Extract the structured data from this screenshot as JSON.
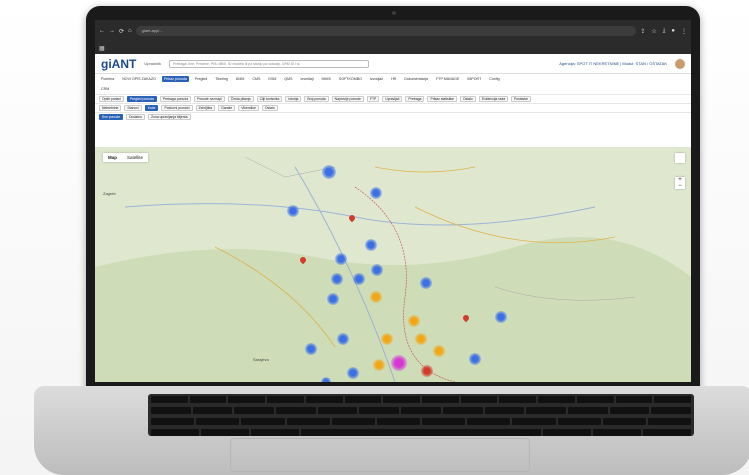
{
  "browser": {
    "url": "giant.app/..."
  },
  "app": {
    "logo": "giANT",
    "user": "Uprawnik",
    "search_placeholder": "Pretraga: Ime, Prezime, PIB, MBS, ID modela ili po stanju po sokaciji, CRM ID i sl.",
    "agency": "Agencija: SPOT IT NEKRETNINE | Modul: STAN / OSTATAK"
  },
  "menu": [
    {
      "label": "Početna",
      "active": false
    },
    {
      "label": "NOVI OPIS ZAKAZO",
      "active": false
    },
    {
      "label": "Prikaz ponuda",
      "active": true
    },
    {
      "label": "Pregled",
      "active": false
    },
    {
      "label": "Tiketing",
      "active": false
    },
    {
      "label": "DMM",
      "active": false
    },
    {
      "label": "CMS",
      "active": false
    },
    {
      "label": "DSM",
      "active": false
    },
    {
      "label": "QMS",
      "active": false
    },
    {
      "label": "Izveštaji",
      "active": false
    },
    {
      "label": "MMIS",
      "active": false
    },
    {
      "label": "SOFTKOMBO",
      "active": false
    },
    {
      "label": "Izvodjač",
      "active": false
    },
    {
      "label": "HR",
      "active": false
    },
    {
      "label": "Dokumentacija",
      "active": false
    },
    {
      "label": "FTP MANAGE",
      "active": false
    },
    {
      "label": "IMPORT",
      "active": false
    },
    {
      "label": "Config",
      "active": false
    },
    {
      "label": "CRM"
    }
  ],
  "sub_tabs_1": [
    "Opšti podaci",
    "Pregled ponuda",
    "Pretraga ponuda",
    "Ponude na mapi",
    "Česta pitanja",
    "Cilji korisnika",
    "Istorija",
    "Broj ponuda",
    "Najnovije ponude",
    "FTP",
    "Upravljač",
    "Pretraga",
    "Prikaz statistike",
    "Ostalo",
    "Evidencija rada",
    "Postavke"
  ],
  "sub_tabs_1_active": 1,
  "sub_tabs_2": [
    "Nekretnine",
    "Stanovi",
    "Kuće",
    "Poslovni prostori",
    "Zemljišta",
    "Garaže",
    "Vikendice",
    "Ostalo"
  ],
  "sub_tabs_2_active": 2,
  "sub_tabs_3": [
    "Sve ponude",
    "Dodatno",
    "Zona upravljanja klijenta"
  ],
  "sub_tabs_3_active": 0,
  "map": {
    "toggle": [
      "Map",
      "Satellite"
    ],
    "zoom_in": "+",
    "zoom_out": "−",
    "labels": [
      "Zagreb",
      "Sarajevo"
    ]
  },
  "colors": {
    "accent": "#2a62b8",
    "cluster_blue": "#3b6fe6",
    "cluster_orange": "#f2a614",
    "cluster_magenta": "#d636d6",
    "pin_red": "#d23a2a"
  }
}
